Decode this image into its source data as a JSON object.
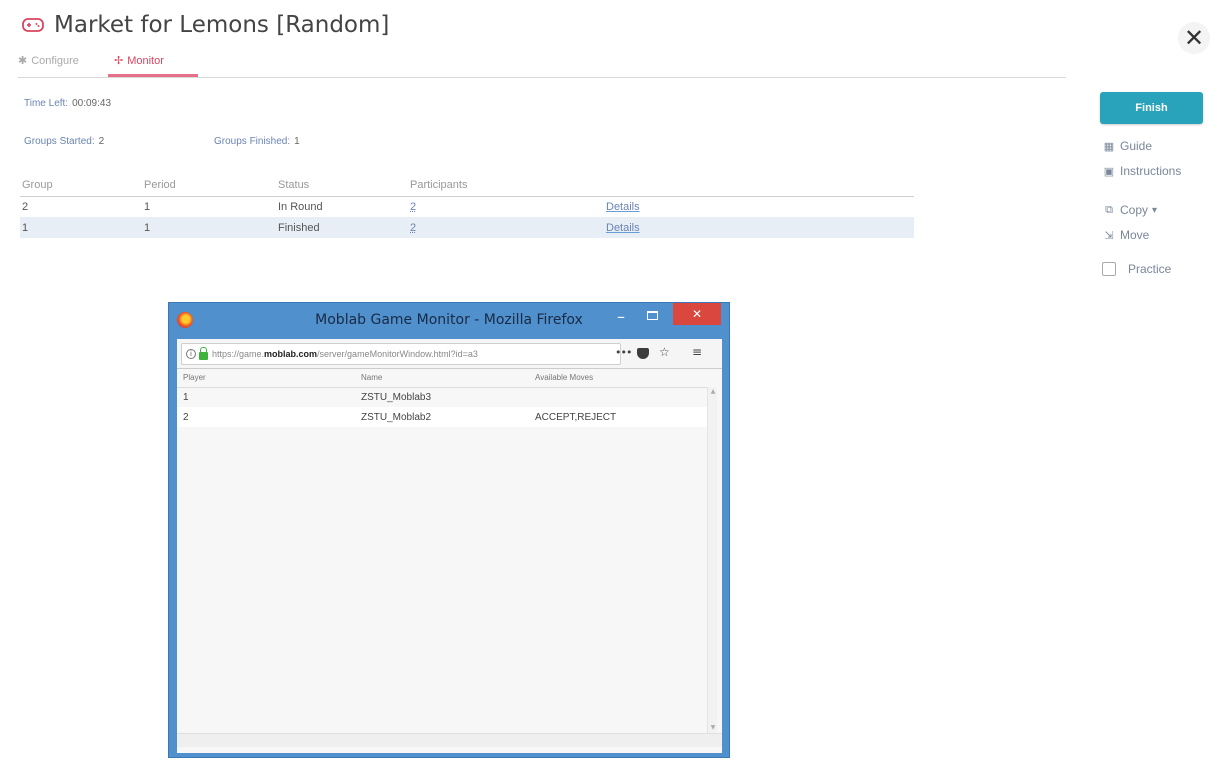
{
  "header": {
    "title": "Market for Lemons [Random]",
    "icon": "gamepad-icon",
    "accent_color": "#d9455f"
  },
  "tabs": [
    {
      "label": "Configure",
      "icon": "wrench-icon",
      "active": false
    },
    {
      "label": "Monitor",
      "icon": "pulse-icon",
      "active": true
    }
  ],
  "stats": {
    "time_left_label": "Time Left:",
    "time_left_value": "00:09:43",
    "groups_started_label": "Groups Started:",
    "groups_started_value": "2",
    "groups_finished_label": "Groups Finished:",
    "groups_finished_value": "1"
  },
  "group_table": {
    "headers": [
      "Group",
      "Period",
      "Status",
      "Participants"
    ],
    "rows": [
      {
        "group": "2",
        "period": "1",
        "status": "In Round",
        "participants": "2",
        "details": "Details"
      },
      {
        "group": "1",
        "period": "1",
        "status": "Finished",
        "participants": "2",
        "details": "Details"
      }
    ]
  },
  "sidebar": {
    "finish_label": "Finish",
    "finish_color": "#29a3bc",
    "guide_label": "Guide",
    "instructions_label": "Instructions",
    "copy_label": "Copy",
    "move_label": "Move",
    "practice_label": "Practice"
  },
  "firefox": {
    "window_title": "Moblab Game Monitor - Mozilla Firefox",
    "url_prefix": "https://game.",
    "url_host": "moblab.com",
    "url_rest": "/server/gameMonitorWindow.html?id=a3",
    "monitor_table": {
      "headers": [
        "Player",
        "Name",
        "Available Moves"
      ],
      "rows": [
        {
          "player": "1",
          "name": "ZSTU_Moblab3",
          "moves": ""
        },
        {
          "player": "2",
          "name": "ZSTU_Moblab2",
          "moves": "ACCEPT,REJECT"
        }
      ]
    }
  }
}
